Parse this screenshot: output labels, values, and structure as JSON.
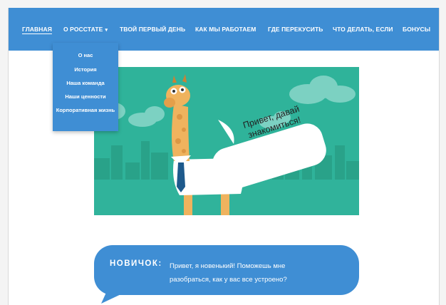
{
  "nav": {
    "items": [
      {
        "label": "ГЛАВНАЯ"
      },
      {
        "label": "О РОССТАТЕ"
      },
      {
        "label": "ТВОЙ ПЕРВЫЙ ДЕНЬ"
      },
      {
        "label": "КАК МЫ РАБОТАЕМ"
      },
      {
        "label": "ГДЕ ПЕРЕКУСИТЬ"
      },
      {
        "label": "ЧТО ДЕЛАТЬ, ЕСЛИ"
      },
      {
        "label": "БОНУСЫ"
      }
    ],
    "dropdown": [
      {
        "label": "О нас"
      },
      {
        "label": "История"
      },
      {
        "label": "Наша команда"
      },
      {
        "label": "Наши ценности"
      },
      {
        "label": "Корпоративная жизнь"
      }
    ]
  },
  "hero": {
    "speech": "Привет, давай знакомиться!"
  },
  "chat": {
    "name": "НОВИЧОК:",
    "message": "Привет, я новенький! Поможешь мне разобраться, как у вас все устроено?"
  },
  "colors": {
    "accent": "#3f8ed4",
    "hero_bg": "#2fb39a",
    "city": "#28a08a"
  }
}
